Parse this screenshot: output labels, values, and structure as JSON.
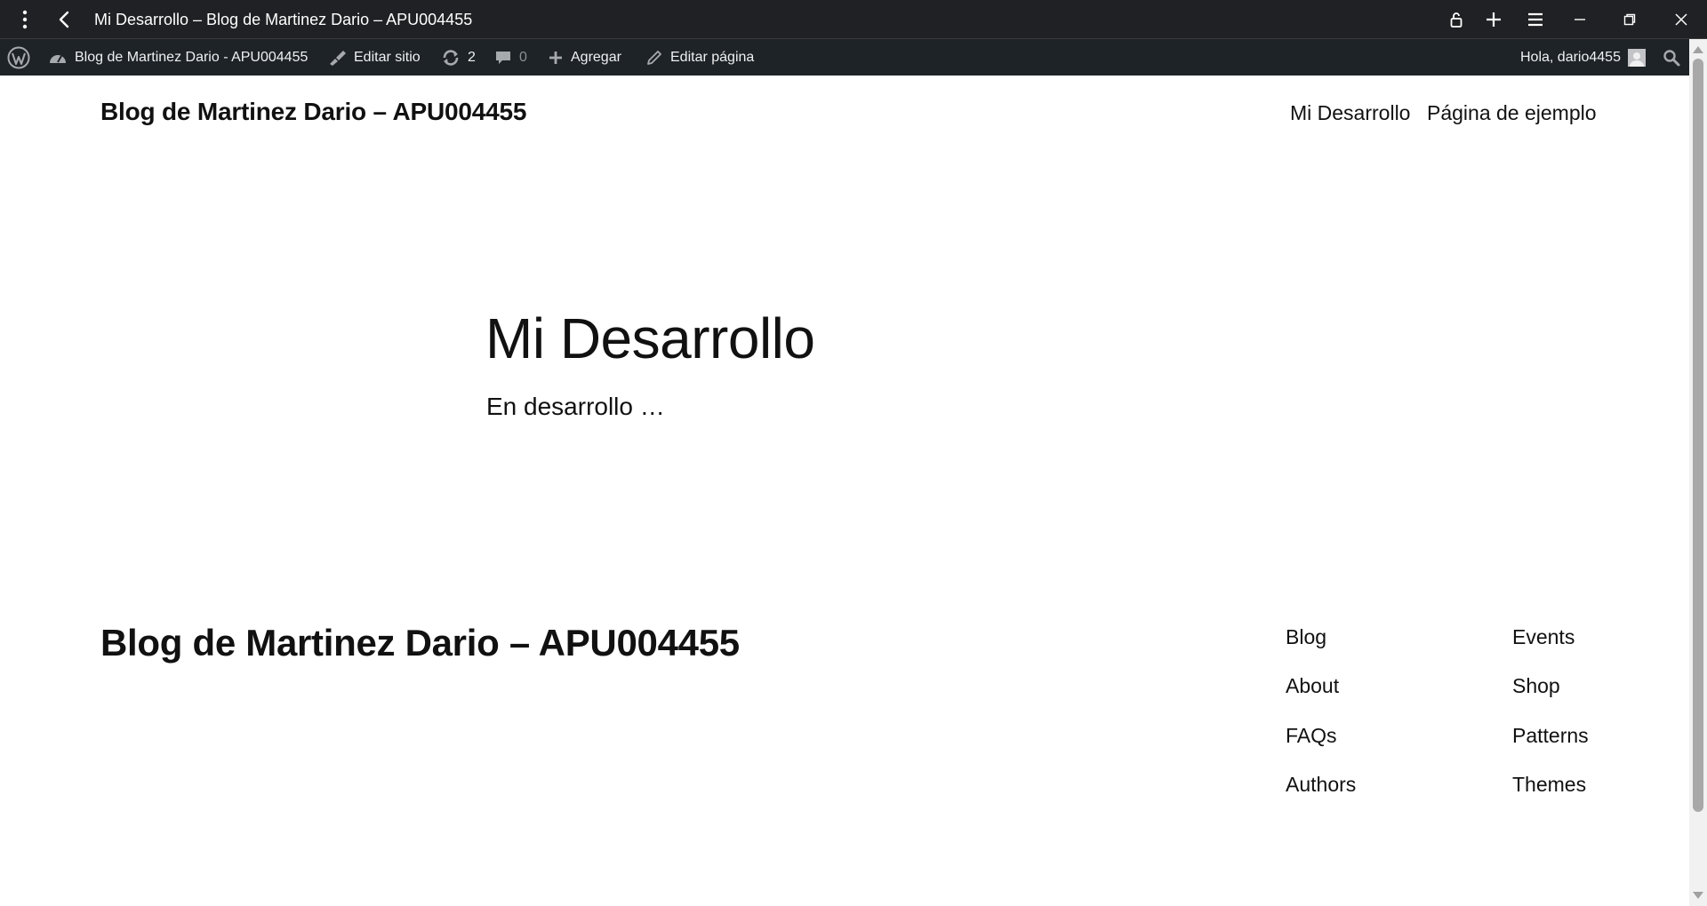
{
  "browser": {
    "title": "Mi Desarrollo – Blog de Martinez Dario – APU004455",
    "icons": [
      "menu-dots-icon",
      "back-icon",
      "lock-icon",
      "plus-icon",
      "hamburger-icon",
      "minimize-icon",
      "restore-icon",
      "close-icon"
    ]
  },
  "adminbar": {
    "site_name": "Blog de Martinez Dario - APU004455",
    "edit_site": "Editar sitio",
    "updates_count": "2",
    "comments_count": "0",
    "add_new": "Agregar",
    "edit_page": "Editar página",
    "greeting": "Hola, dario4455"
  },
  "header": {
    "site_title": "Blog de Martinez Dario – APU004455",
    "nav": [
      "Mi Desarrollo",
      "Página de ejemplo"
    ]
  },
  "main": {
    "title": "Mi Desarrollo",
    "text": "En desarrollo …"
  },
  "footer": {
    "site_title": "Blog de Martinez Dario – APU004455",
    "col1": [
      "Blog",
      "About",
      "FAQs",
      "Authors"
    ],
    "col2": [
      "Events",
      "Shop",
      "Patterns",
      "Themes"
    ]
  },
  "colors": {
    "titlebar_bg": "#202124",
    "adminbar_bg": "#1d2327",
    "page_bg": "#ffffff",
    "text": "#111111"
  }
}
